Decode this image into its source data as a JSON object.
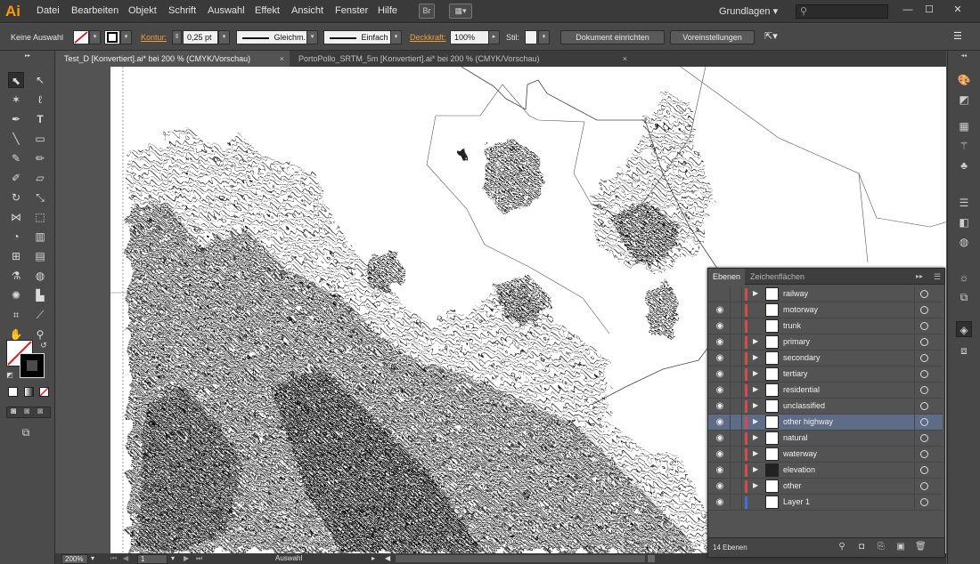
{
  "app": {
    "logo": "Ai"
  },
  "menu": {
    "items": [
      "Datei",
      "Bearbeiten",
      "Objekt",
      "Schrift",
      "Auswahl",
      "Effekt",
      "Ansicht",
      "Fenster",
      "Hilfe"
    ],
    "br_label": "Br",
    "workspace": "Grundlagen",
    "search_placeholder": ""
  },
  "control": {
    "selection": "Keine Auswahl",
    "stroke_label": "Kontur:",
    "stroke_weight": "0,25 pt",
    "profile": "Gleichm.",
    "brush": "Einfach",
    "opacity_label": "Deckkraft:",
    "opacity": "100%",
    "style_label": "Stil:",
    "doc_setup": "Dokument einrichten",
    "preferences": "Voreinstellungen"
  },
  "tabs": [
    {
      "label": "Test_D [Konvertiert].ai* bei 200 % (CMYK/Vorschau)",
      "close": "×"
    },
    {
      "label": "PortoPollo_SRTM_5m [Konvertiert].ai* bei 200 % (CMYK/Vorschau)",
      "close": "×"
    }
  ],
  "status": {
    "zoom": "200%",
    "page": "1",
    "mode": "Auswahl"
  },
  "layers_panel": {
    "tab_layers": "Ebenen",
    "tab_artboards": "Zeichenflächen",
    "count": "14 Ebenen",
    "layers": [
      {
        "name": "railway",
        "visible": false,
        "expandable": true,
        "color": "#d84a4a",
        "selected": false
      },
      {
        "name": "motorway",
        "visible": true,
        "expandable": false,
        "color": "#d84a4a",
        "selected": false
      },
      {
        "name": "trunk",
        "visible": true,
        "expandable": false,
        "color": "#d84a4a",
        "selected": false
      },
      {
        "name": "primary",
        "visible": true,
        "expandable": true,
        "color": "#d84a4a",
        "selected": false
      },
      {
        "name": "secondary",
        "visible": true,
        "expandable": true,
        "color": "#d84a4a",
        "selected": false
      },
      {
        "name": "tertiary",
        "visible": true,
        "expandable": true,
        "color": "#d84a4a",
        "selected": false
      },
      {
        "name": "residential",
        "visible": true,
        "expandable": true,
        "color": "#d84a4a",
        "selected": false
      },
      {
        "name": "unclassified",
        "visible": true,
        "expandable": true,
        "color": "#d84a4a",
        "selected": false
      },
      {
        "name": "other highway",
        "visible": true,
        "expandable": true,
        "color": "#d84a4a",
        "selected": true
      },
      {
        "name": "natural",
        "visible": true,
        "expandable": true,
        "color": "#d84a4a",
        "selected": false
      },
      {
        "name": "waterway",
        "visible": true,
        "expandable": true,
        "color": "#d84a4a",
        "selected": false
      },
      {
        "name": "elevation",
        "visible": true,
        "expandable": true,
        "color": "#d84a4a",
        "selected": false
      },
      {
        "name": "other",
        "visible": true,
        "expandable": true,
        "color": "#d84a4a",
        "selected": false
      },
      {
        "name": "Layer 1",
        "visible": true,
        "expandable": false,
        "color": "#4a6ad8",
        "selected": false
      }
    ]
  },
  "icons": {
    "eye": "eye-icon",
    "target": "target-circle-icon",
    "expand": "disclosure-triangle-icon"
  }
}
